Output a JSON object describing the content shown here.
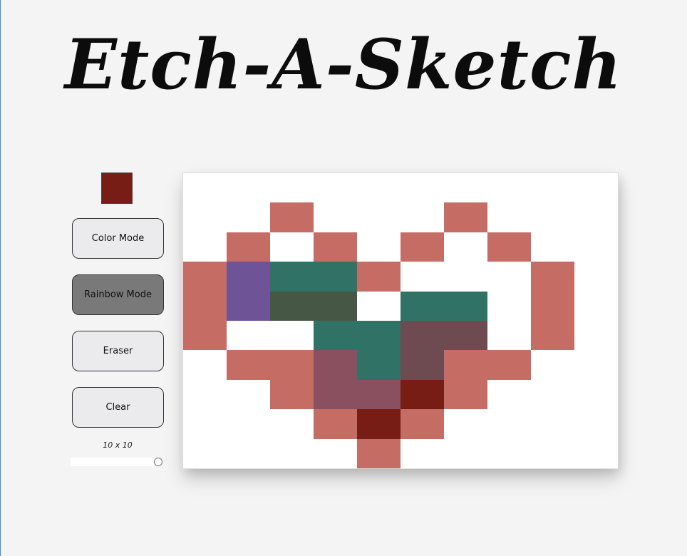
{
  "title": "Etch-A-Sketch",
  "current_color": "#771d16",
  "buttons": {
    "color_mode": "Color Mode",
    "rainbow_mode": "Rainbow Mode",
    "eraser": "Eraser",
    "clear": "Clear"
  },
  "active_mode": "rainbow_mode",
  "grid_size_label": "10 x 10",
  "grid_size": 10,
  "grid_size_slider_fraction": 1.0,
  "palette": {
    "W": "#ffffff",
    "R": "#c56c65",
    "P": "#6e5397",
    "T": "#307266",
    "G": "#465845",
    "M": "#6e4b50",
    "K": "#8a5060",
    "D": "#771d16"
  },
  "grid": [
    "WWWWWWWWWW",
    "WWRWWWRWWW",
    "WRWRWRWRWW",
    "RPTTRWWWRW",
    "RPGGWTTWRW",
    "RWWTTMMWRW",
    "WRRKTMRRWW",
    "WWRKKDRWWW",
    "WWWRDRWWWW",
    "WWWWRWWWWW"
  ]
}
